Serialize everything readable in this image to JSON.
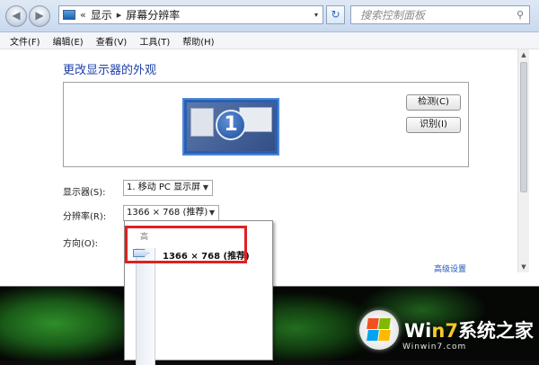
{
  "nav": {
    "back": "◀",
    "forward": "▶"
  },
  "address": {
    "overflow": "«",
    "crumb1": "显示",
    "separator": "▸",
    "crumb2": "屏幕分辨率",
    "dropdown": "▾"
  },
  "refresh_glyph": "↻",
  "search": {
    "placeholder": "搜索控制面板",
    "icon": "search-icon"
  },
  "menu": [
    "文件(F)",
    "编辑(E)",
    "查看(V)",
    "工具(T)",
    "帮助(H)"
  ],
  "page": {
    "heading": "更改显示器的外观",
    "monitor_number": "1",
    "detect_button": "检测(C)",
    "identify_button": "识别(I)",
    "display_label": "显示器(S):",
    "display_value": "1. 移动 PC 显示屏",
    "resolution_label": "分辨率(R):",
    "resolution_value": "1366 × 768 (推荐)",
    "orientation_label": "方向(O):",
    "advanced_link": "高级设置"
  },
  "resolution_popup": {
    "high_label": "高",
    "current": "1366 × 768 (推荐)",
    "slider_level": 1.0
  },
  "watermark": {
    "brand_prefix": "Wi",
    "brand_digit": "n7",
    "brand_suffix": "系统之家",
    "url": "Winwin7.com"
  },
  "colors": {
    "heading": "#1e3fa8",
    "link": "#2256b8",
    "highlight_box": "#e02020"
  }
}
